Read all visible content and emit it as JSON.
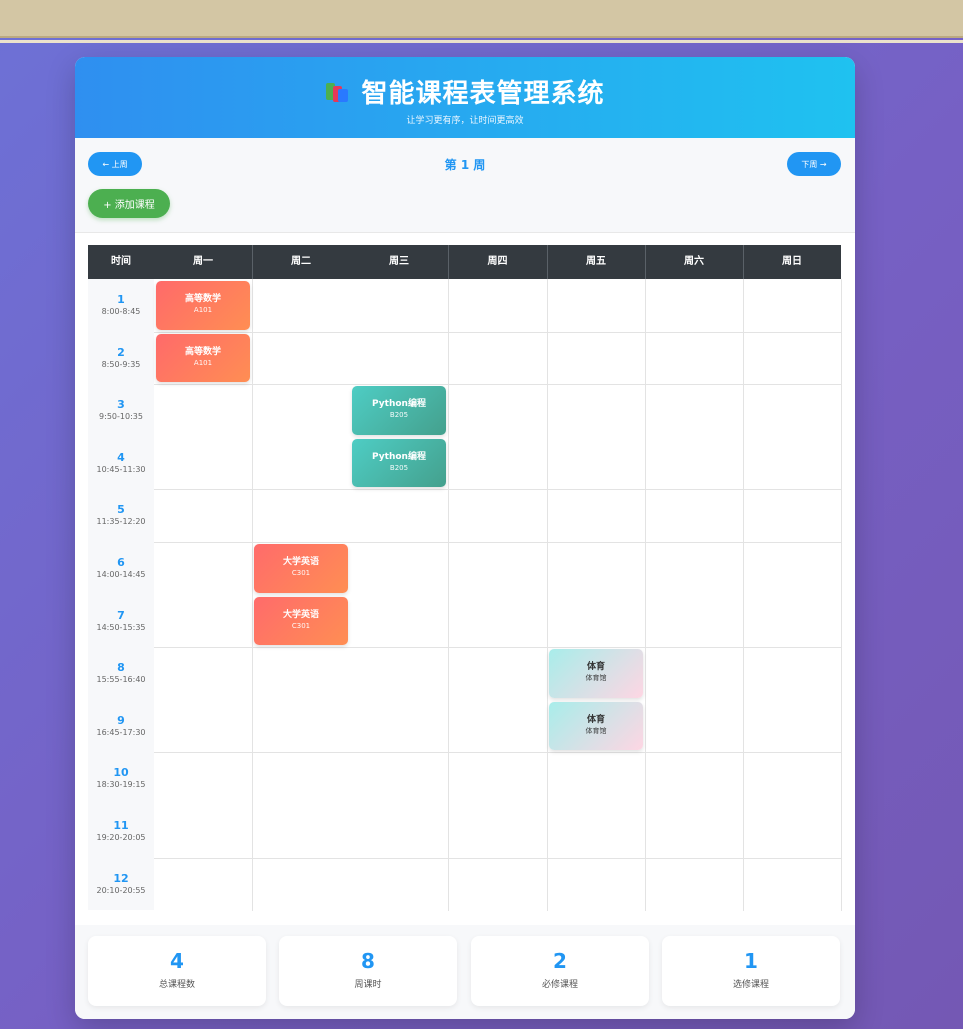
{
  "header": {
    "title": "智能课程表管理系统",
    "subtitle": "让学习更有序，让时间更高效"
  },
  "controls": {
    "prev_label": "← 上周",
    "week_label": "第 1 周",
    "next_label": "下周 →",
    "add_label": "+ 添加课程"
  },
  "table": {
    "headers": [
      "时间",
      "周一",
      "周二",
      "周三",
      "周四",
      "周五",
      "周六",
      "周日"
    ],
    "periods": [
      {
        "num": "1",
        "time": "8:00-8:45"
      },
      {
        "num": "2",
        "time": "8:50-9:35"
      },
      {
        "num": "3",
        "time": "9:50-10:35"
      },
      {
        "num": "4",
        "time": "10:45-11:30"
      },
      {
        "num": "5",
        "time": "11:35-12:20"
      },
      {
        "num": "6",
        "time": "14:00-14:45"
      },
      {
        "num": "7",
        "time": "14:50-15:35"
      },
      {
        "num": "8",
        "time": "15:55-16:40"
      },
      {
        "num": "9",
        "time": "16:45-17:30"
      },
      {
        "num": "10",
        "time": "18:30-19:15"
      },
      {
        "num": "11",
        "time": "19:20-20:05"
      },
      {
        "num": "12",
        "time": "20:10-20:55"
      }
    ],
    "courses": [
      {
        "name": "高等数学",
        "room": "A101",
        "day": "周一",
        "period": "1",
        "style": "math"
      },
      {
        "name": "高等数学",
        "room": "A101",
        "day": "周一",
        "period": "2",
        "style": "math"
      },
      {
        "name": "Python编程",
        "room": "B205",
        "day": "周三",
        "period": "3",
        "style": "py"
      },
      {
        "name": "Python编程",
        "room": "B205",
        "day": "周三",
        "period": "4",
        "style": "py"
      },
      {
        "name": "大学英语",
        "room": "C301",
        "day": "周二",
        "period": "6",
        "style": "en"
      },
      {
        "name": "大学英语",
        "room": "C301",
        "day": "周二",
        "period": "7",
        "style": "en"
      },
      {
        "name": "体育",
        "room": "体育馆",
        "day": "周五",
        "period": "8",
        "style": "pe"
      },
      {
        "name": "体育",
        "room": "体育馆",
        "day": "周五",
        "period": "9",
        "style": "pe"
      }
    ]
  },
  "stats": [
    {
      "value": "4",
      "label": "总课程数"
    },
    {
      "value": "8",
      "label": "周课时"
    },
    {
      "value": "2",
      "label": "必修课程"
    },
    {
      "value": "1",
      "label": "选修课程"
    }
  ],
  "colors": {
    "accent": "#2196f3",
    "add_button": "#4caf50",
    "table_header": "#343a40"
  }
}
